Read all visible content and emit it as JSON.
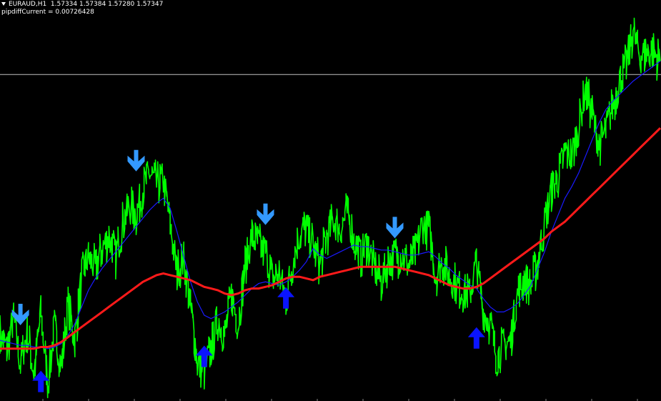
{
  "header": {
    "symbol_line": "EURAUD,H1  1.57334 1.57384 1.57280 1.57347",
    "indicator_line": "pipdiffCurrent = 0.00726428"
  },
  "colors": {
    "background": "#000000",
    "price": "#00ff00",
    "fast_ma": "#1a1aff",
    "slow_ma": "#ff1a1a",
    "arrow_buy": "#0a14ff",
    "arrow_sell": "#3399ff",
    "hline": "#c0c0c0",
    "text": "#ffffff"
  },
  "chart_data": {
    "type": "line",
    "series": [
      {
        "key": "price",
        "values": [
          0.38,
          0.3,
          0.48,
          0.21,
          0.4,
          0.15,
          0.52,
          0.1,
          0.42,
          0.2,
          0.55,
          0.35,
          0.73,
          0.85,
          0.78,
          0.9,
          0.97,
          0.85,
          1.05,
          1.15,
          1.1,
          1.25,
          1.35,
          1.28,
          1.31,
          1.05,
          0.76,
          0.84,
          0.55,
          0.22,
          0.17,
          0.3,
          0.48,
          0.38,
          0.62,
          0.45,
          0.8,
          0.97,
          0.92,
          0.88,
          0.72,
          0.75,
          0.6,
          0.82,
          0.98,
          1.03,
          0.92,
          0.8,
          0.98,
          1.07,
          1.01,
          1.12,
          0.95,
          0.85,
          0.94,
          0.78,
          0.7,
          0.82,
          0.86,
          0.86,
          0.8,
          0.86,
          1.04,
          1.02,
          0.74,
          0.82,
          0.74,
          0.68,
          0.65,
          0.62,
          0.82,
          0.52,
          0.45,
          0.25,
          0.32,
          0.35,
          0.62,
          0.72,
          0.68,
          0.82,
          1.05,
          1.25,
          1.32,
          1.48,
          1.45,
          1.62,
          1.85,
          1.7,
          1.52,
          1.6,
          1.75,
          1.9,
          2.0,
          2.2,
          2.05,
          2.07,
          2.07,
          2.02
        ]
      },
      {
        "key": "fast_ma",
        "values": [
          0.35,
          0.34,
          0.33,
          0.32,
          0.32,
          0.31,
          0.31,
          0.3,
          0.31,
          0.33,
          0.38,
          0.45,
          0.55,
          0.65,
          0.72,
          0.78,
          0.83,
          0.88,
          0.93,
          0.98,
          1.03,
          1.08,
          1.13,
          1.17,
          1.2,
          1.14,
          1.0,
          0.85,
          0.7,
          0.58,
          0.5,
          0.48,
          0.5,
          0.52,
          0.55,
          0.58,
          0.62,
          0.66,
          0.69,
          0.7,
          0.69,
          0.68,
          0.7,
          0.73,
          0.77,
          0.82,
          0.9,
          0.86,
          0.84,
          0.86,
          0.88,
          0.9,
          0.92,
          0.91,
          0.91,
          0.9,
          0.89,
          0.89,
          0.88,
          0.87,
          0.86,
          0.86,
          0.87,
          0.88,
          0.85,
          0.81,
          0.78,
          0.74,
          0.71,
          0.68,
          0.66,
          0.6,
          0.55,
          0.52,
          0.52,
          0.54,
          0.57,
          0.62,
          0.68,
          0.78,
          0.88,
          1.0,
          1.1,
          1.2,
          1.27,
          1.35,
          1.45,
          1.55,
          1.65,
          1.73,
          1.78,
          1.82,
          1.86,
          1.9,
          1.93,
          1.96,
          1.99,
          2.02
        ]
      },
      {
        "key": "slow_ma",
        "values": [
          0.3,
          0.3,
          0.3,
          0.3,
          0.3,
          0.3,
          0.31,
          0.31,
          0.32,
          0.34,
          0.37,
          0.4,
          0.43,
          0.46,
          0.49,
          0.52,
          0.55,
          0.58,
          0.61,
          0.64,
          0.67,
          0.7,
          0.72,
          0.74,
          0.75,
          0.74,
          0.73,
          0.72,
          0.71,
          0.69,
          0.67,
          0.66,
          0.65,
          0.63,
          0.62,
          0.63,
          0.65,
          0.66,
          0.66,
          0.67,
          0.68,
          0.7,
          0.72,
          0.73,
          0.73,
          0.72,
          0.71,
          0.73,
          0.74,
          0.75,
          0.76,
          0.77,
          0.78,
          0.79,
          0.79,
          0.79,
          0.79,
          0.79,
          0.79,
          0.78,
          0.77,
          0.76,
          0.75,
          0.74,
          0.72,
          0.7,
          0.68,
          0.67,
          0.66,
          0.66,
          0.67,
          0.69,
          0.72,
          0.75,
          0.78,
          0.81,
          0.84,
          0.87,
          0.9,
          0.93,
          0.96,
          1.0,
          1.03,
          1.06,
          1.1,
          1.14,
          1.18,
          1.22,
          1.26,
          1.3,
          1.34,
          1.38,
          1.42,
          1.46,
          1.5,
          1.54,
          1.58,
          1.62
        ]
      }
    ],
    "markers": [
      {
        "type": "sell",
        "index": 3,
        "value": 0.5
      },
      {
        "type": "buy",
        "index": 6,
        "value": 0.1
      },
      {
        "type": "sell",
        "index": 20,
        "value": 1.42
      },
      {
        "type": "buy",
        "index": 30,
        "value": 0.25
      },
      {
        "type": "sell",
        "index": 39,
        "value": 1.1
      },
      {
        "type": "buy",
        "index": 42,
        "value": 0.6
      },
      {
        "type": "sell",
        "index": 58,
        "value": 1.02
      },
      {
        "type": "buy",
        "index": 70,
        "value": 0.36
      }
    ],
    "ylim": [
      0,
      2.3
    ],
    "hline": 1.94
  }
}
